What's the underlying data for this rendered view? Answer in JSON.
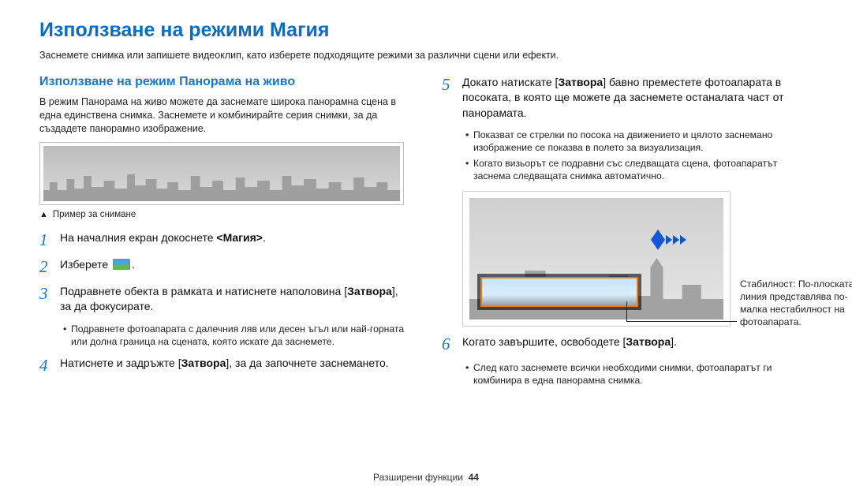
{
  "page": {
    "title": "Използване на режими Магия",
    "intro": "Заснемете снимка или запишете видеоклип, като изберете подходящите режими за различни сцени или ефекти."
  },
  "section": {
    "heading": "Използване на режим Панорама на живо",
    "intro": "В режим Панорама на живо можете да заснемате широка панорамна сцена в една единствена снимка. Заснемете и комбинирайте серия снимки, за да създадете панорамно изображение.",
    "caption": "Пример за снимане"
  },
  "steps": {
    "s1_pre": "На началния екран докоснете ",
    "s1_bold": "<Магия>",
    "s1_post": ".",
    "s2_pre": "Изберете ",
    "s2_post": ".",
    "s3_pre": "Подравнете обекта в рамката и натиснете наполовина [",
    "s3_bold": "Затвора",
    "s3_post": "], за да фокусирате.",
    "s3_sub1": "Подравнете фотоапарата с далечния ляв или десен ъгъл или най-горната или долна граница на сцената, която искате да заснемете.",
    "s4_pre": "Натиснете и задръжте [",
    "s4_bold": "Затвора",
    "s4_post": "], за да започнете заснемането.",
    "s5_pre": "Докато натискате [",
    "s5_bold": "Затвора",
    "s5_post": "] бавно преместете фотоапарата в посоката, в която ще можете да заснемете останалата част от панорамата.",
    "s5_sub1": "Показват се стрелки по посока на движението и цялото заснемано изображение се показва в полето за визуализация.",
    "s5_sub2": "Когато визьорът се подравни със следващата сцена, фотоапаратът заснема следващата снимка автоматично.",
    "s6_pre": "Когато завършите, освободете [",
    "s6_bold": "Затвора",
    "s6_post": "].",
    "s6_sub1": "След като заснемете всички необходими снимки, фотоапаратът ги комбинира в една панорамна снимка."
  },
  "callout": {
    "text": "Стабилност: По-плоската линия представлява по-малка нестабилност на фотоапарата."
  },
  "footer": {
    "section": "Разширени функции",
    "page": "44"
  }
}
